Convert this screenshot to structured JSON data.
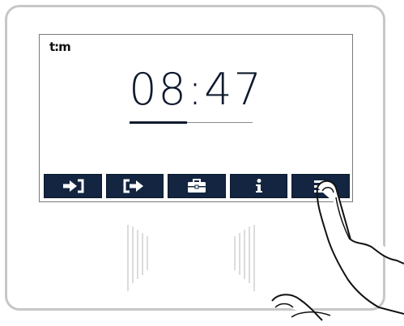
{
  "logo": {
    "text": "t:m"
  },
  "clock": {
    "time": "08:47",
    "progress": 0.47
  },
  "toolbar": {
    "buttons": [
      {
        "icon": "sign-in-icon"
      },
      {
        "icon": "sign-out-icon"
      },
      {
        "icon": "briefcase-icon"
      },
      {
        "icon": "info-icon"
      },
      {
        "icon": "menu-list-icon"
      }
    ]
  },
  "colors": {
    "toolbar_bg": "#132540",
    "clock_text": "#0f1a2e",
    "device_border": "#c7c7c7"
  }
}
